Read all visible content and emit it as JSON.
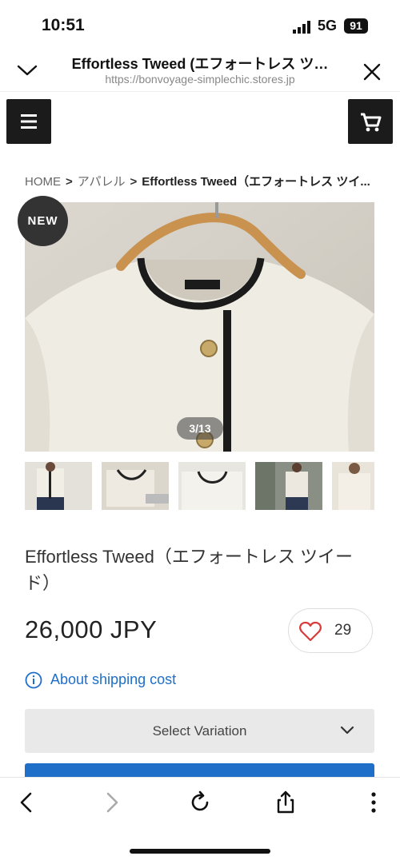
{
  "status_bar": {
    "time": "10:51",
    "network": "5G",
    "battery": "91"
  },
  "browser": {
    "title": "Effortless Tweed (エフォートレス ツ…",
    "url": "https://bonvoyage-simplechic.stores.jp"
  },
  "breadcrumb": {
    "home": "HOME",
    "category": "アパレル",
    "current": "Effortless Tweed（エフォートレス ツイ..."
  },
  "product": {
    "badge": "NEW",
    "image_counter": "3/13",
    "name": "Effortless Tweed（エフォートレス ツイード）",
    "price": "26,000 JPY",
    "like_count": "29",
    "shipping_link": "About shipping cost",
    "variation_placeholder": "Select Variation",
    "thumbnail_count": 5
  },
  "colors": {
    "accent": "#1f6fc8",
    "dark_button": "#1b1b1b",
    "heart": "#d93b3b"
  },
  "icons": {
    "header_left": "chevron-down-icon",
    "header_right": "close-icon",
    "menu": "hamburger-icon",
    "cart": "cart-icon",
    "like": "heart-icon",
    "info": "info-icon",
    "toolbar": [
      "back-icon",
      "forward-icon",
      "reload-icon",
      "share-icon",
      "more-icon"
    ]
  }
}
